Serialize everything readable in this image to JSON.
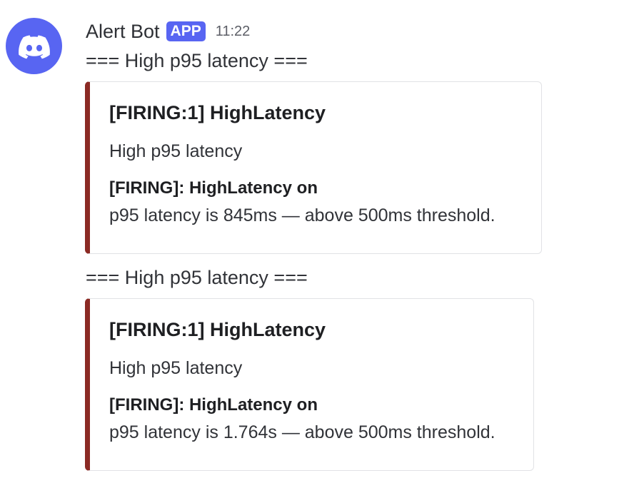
{
  "message": {
    "author": "Alert Bot",
    "badge": "APP",
    "timestamp": "11:22",
    "avatar_icon": "discord-logo-icon",
    "accent_color": "#5865f2"
  },
  "alerts": [
    {
      "heading": "=== High p95 latency ===",
      "embed": {
        "border_color": "#8b2a24",
        "title": "[FIRING:1] HighLatency",
        "description": "High p95 latency",
        "field_name": "[FIRING]: HighLatency on",
        "field_value": "p95 latency is 845ms — above 500ms threshold."
      }
    },
    {
      "heading": "=== High p95 latency ===",
      "embed": {
        "border_color": "#8b2a24",
        "title": "[FIRING:1] HighLatency",
        "description": "High p95 latency",
        "field_name": "[FIRING]: HighLatency on",
        "field_value": "p95 latency is 1.764s — above 500ms threshold."
      }
    }
  ]
}
